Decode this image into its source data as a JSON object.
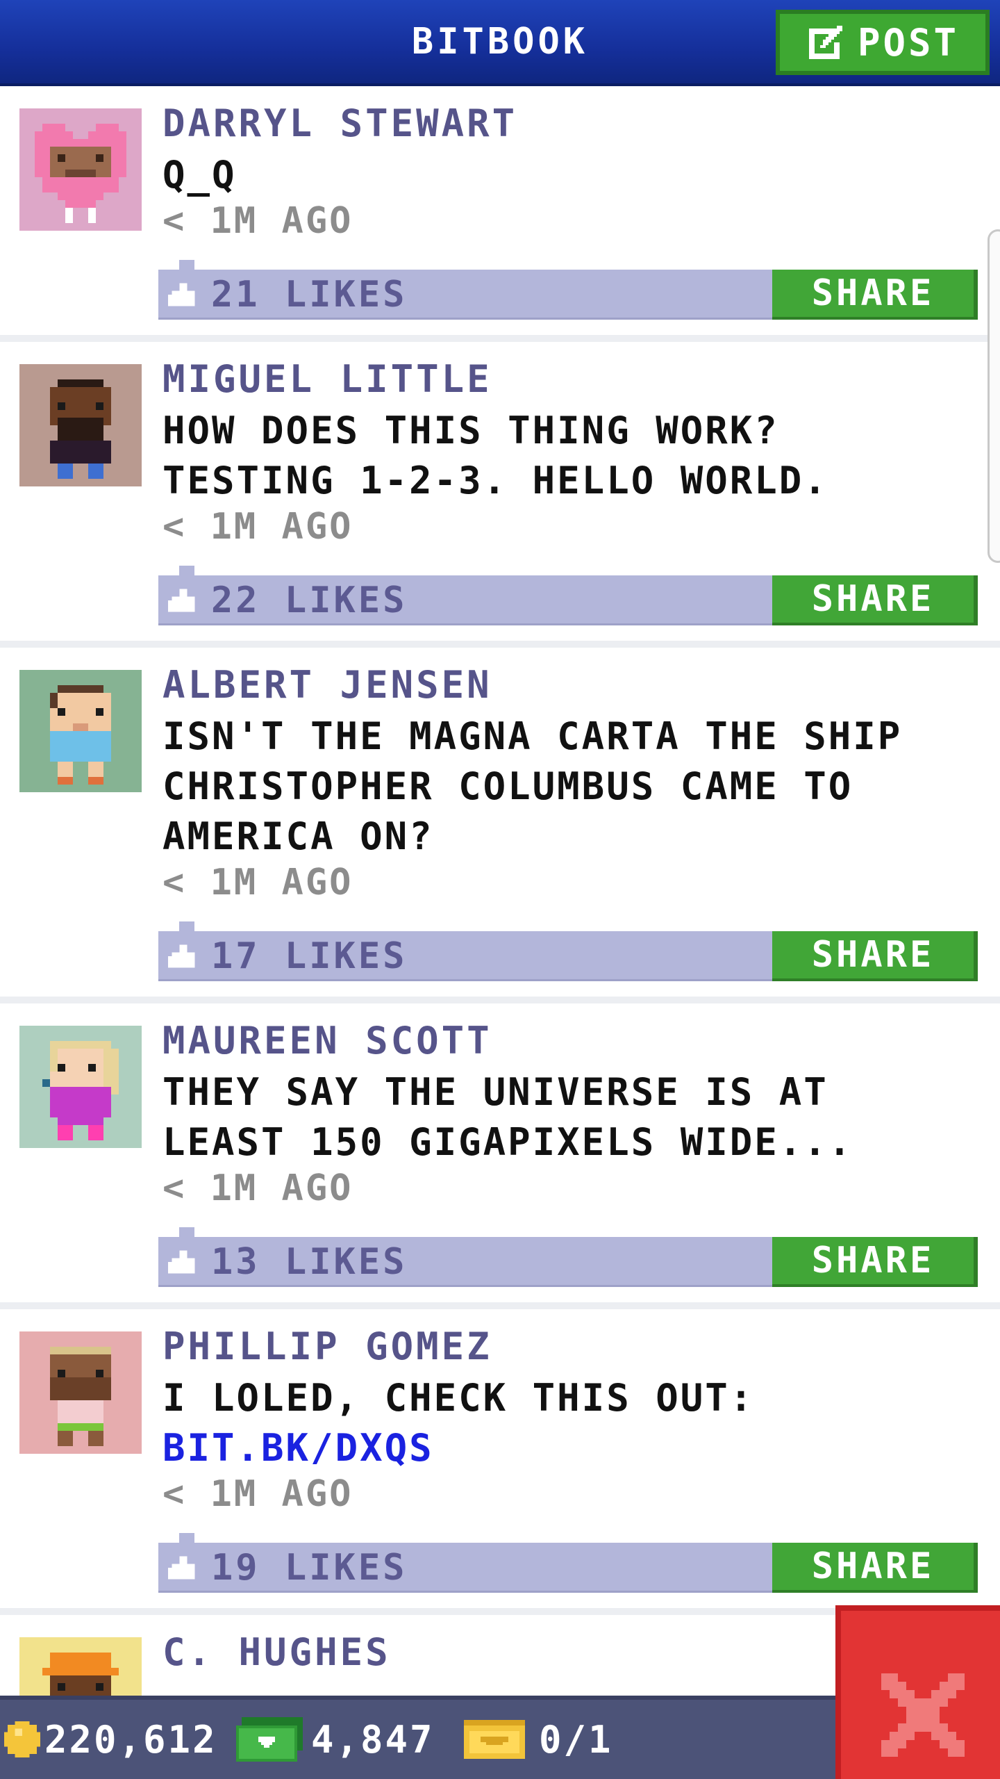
{
  "header": {
    "title": "BITBOOK",
    "post_label": "POST"
  },
  "posts": [
    {
      "author": "DARRYL STEWART",
      "message": "Q_Q",
      "link": "",
      "time": "< 1M AGO",
      "likes": "21 LIKES",
      "share_label": "SHARE",
      "avatar": "pink-heart-avatar"
    },
    {
      "author": "MIGUEL LITTLE",
      "message": "HOW DOES THIS THING WORK? TESTING 1-2-3. HELLO WORLD.",
      "link": "",
      "time": "< 1M AGO",
      "likes": "22 LIKES",
      "share_label": "SHARE",
      "avatar": "bearded-man-avatar"
    },
    {
      "author": "ALBERT JENSEN",
      "message": "ISN'T THE MAGNA CARTA THE SHIP CHRISTOPHER COLUMBUS CAME TO AMERICA ON?",
      "link": "",
      "time": "< 1M AGO",
      "likes": "17 LIKES",
      "share_label": "SHARE",
      "avatar": "blue-shirt-man-avatar"
    },
    {
      "author": "MAUREEN SCOTT",
      "message": "THEY SAY THE UNIVERSE IS AT LEAST 150 GIGAPIXELS WIDE...",
      "link": "",
      "time": "< 1M AGO",
      "likes": "13 LIKES",
      "share_label": "SHARE",
      "avatar": "blonde-woman-avatar"
    },
    {
      "author": "PHILLIP GOMEZ",
      "message": "I LOLED, CHECK THIS OUT:",
      "link": "BIT.BK/DXQS",
      "time": "< 1M AGO",
      "likes": "19 LIKES",
      "share_label": "SHARE",
      "avatar": "blond-bearded-man-avatar"
    },
    {
      "author": "C. HUGHES",
      "message": "",
      "link": "",
      "time": "",
      "likes": "",
      "share_label": "",
      "avatar": "hardhat-worker-avatar"
    }
  ],
  "status_bar": {
    "coins": "220,612",
    "bux": "4,847",
    "tickets": "0/1"
  },
  "colors": {
    "header_blue": "#1a3aa8",
    "share_green": "#41a637",
    "like_bar": "#b3b6da",
    "link_blue": "#1a22e0",
    "close_red": "#e23434"
  },
  "icons": {
    "post": "edit-icon",
    "like": "thumbs-up-icon",
    "coin": "coin-icon",
    "bux": "cash-icon",
    "ticket": "ticket-icon",
    "close": "close-icon"
  }
}
